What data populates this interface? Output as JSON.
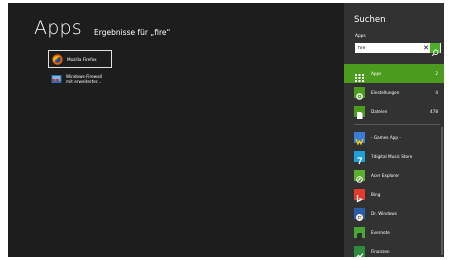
{
  "results": {
    "heading": "Apps",
    "subtitle": "Ergebnisse für „fire“",
    "items": [
      {
        "label": "Mozilla Firefox",
        "icon": "firefox-icon",
        "selected": true
      },
      {
        "label": "Windows-Firewall\nmit erweiterter...",
        "icon": "firewall-icon",
        "selected": false
      }
    ]
  },
  "search_pane": {
    "title": "Suchen",
    "scope_label": "Apps",
    "query": "fire",
    "clear_glyph": "✕",
    "categories": [
      {
        "label": "Apps",
        "count": "2",
        "icon": "apps-icon",
        "active": true
      },
      {
        "label": "Einstellungen",
        "count": "4",
        "icon": "settings-icon",
        "active": false
      },
      {
        "label": "Dateien",
        "count": "478",
        "icon": "files-icon",
        "active": false
      }
    ],
    "apps": [
      {
        "label": "- Games App -",
        "icon": "games-app-icon",
        "color": "#3a7bd5"
      },
      {
        "label": "7digital Music Store",
        "icon": "7digital-icon",
        "color": "#1e9fd8"
      },
      {
        "label": "Acer Explorer",
        "icon": "acer-explorer-icon",
        "color": "#5cae2e"
      },
      {
        "label": "Bing",
        "icon": "bing-icon",
        "color": "#e53b2f"
      },
      {
        "label": "Dr. Windows",
        "icon": "dr-windows-icon",
        "color": "#2a5ea8"
      },
      {
        "label": "Evernote",
        "icon": "evernote-icon",
        "color": "#4aa632"
      },
      {
        "label": "Finanzen",
        "icon": "finance-icon",
        "color": "#2e8b3d"
      }
    ]
  }
}
